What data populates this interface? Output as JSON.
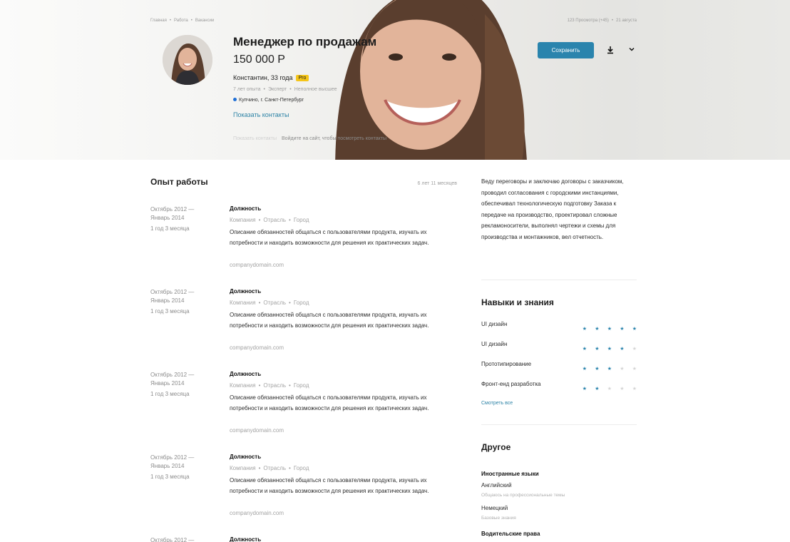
{
  "breadcrumb": [
    "Главная",
    "Работа",
    "Вакансии"
  ],
  "header_meta": {
    "views": "123 Просмотра (+45)",
    "date": "21 августа"
  },
  "profile": {
    "title": "Менеджер по продажам",
    "salary": "150 000 Р",
    "person": "Константин, 33 года",
    "badge": "Pro",
    "experience_meta": [
      "7 лет опыта",
      "Эксперт",
      "Неполное высшее"
    ],
    "location": "Купчино, г. Санкт-Петербург",
    "contacts_link": "Показать контакты",
    "contacts_ghost": "Показать контакты",
    "login_hint": "Войдите на сайт, чтобы посмотреть контакты"
  },
  "actions": {
    "save": "Сохранить",
    "download_icon": "download-icon",
    "more_icon": "chevron-down-icon"
  },
  "experience": {
    "title": "Опыт работы",
    "total": "6 лет 11 месяцев",
    "items": [
      {
        "dates": "Октябрь 2012 — Январь 2014",
        "duration": "1 год 3 месяца",
        "position": "Должность",
        "company": "Компания",
        "industry": "Отрасль",
        "city": "Город",
        "description": "Описание обязанностей общаться с пользователями продукта, изучать их потребности и находить возможности для решения их практических задач.",
        "domain": "companydomain.com"
      },
      {
        "dates": "Октябрь 2012 — Январь 2014",
        "duration": "1 год 3 месяца",
        "position": "Должность",
        "company": "Компания",
        "industry": "Отрасль",
        "city": "Город",
        "description": "Описание обязанностей общаться с пользователями продукта, изучать их потребности и находить возможности для решения их практических задач.",
        "domain": "companydomain.com"
      },
      {
        "dates": "Октябрь 2012 — Январь 2014",
        "duration": "1 год 3 месяца",
        "position": "Должность",
        "company": "Компания",
        "industry": "Отрасль",
        "city": "Город",
        "description": "Описание обязанностей общаться с пользователями продукта, изучать их потребности и находить возможности для решения их практических задач.",
        "domain": "companydomain.com"
      },
      {
        "dates": "Октябрь 2012 — Январь 2014",
        "duration": "1 год 3 месяца",
        "position": "Должность",
        "company": "Компания",
        "industry": "Отрасль",
        "city": "Город",
        "description": "Описание обязанностей общаться с пользователями продукта, изучать их потребности и находить возможности для решения их практических задач.",
        "domain": "companydomain.com"
      },
      {
        "dates": "Октябрь 2012 —",
        "duration": "",
        "position": "Должность",
        "company": "",
        "industry": "",
        "city": "",
        "description": "",
        "domain": ""
      }
    ]
  },
  "about": "Веду переговоры и заключаю договоры с заказчиком, проводил согласования с городскими инстанциями, обеспечивал технологическую подготовку Заказа к передаче на производство, проектировал сложные рекламоносители, выполнял чертежи и схемы для производства и монтажников, вел отчетность.",
  "skills": {
    "title": "Навыки и знания",
    "max_rating": 5,
    "items": [
      {
        "name": "UI дизайн",
        "rating": 5
      },
      {
        "name": "UI дизайн",
        "rating": 4
      },
      {
        "name": "Прототипирование",
        "rating": 3
      },
      {
        "name": "Фронт-енд разработка",
        "rating": 2
      }
    ],
    "see_all": "Смотреть все"
  },
  "other": {
    "title": "Другое",
    "languages_title": "Иностранные языки",
    "languages": [
      {
        "name": "Английский",
        "level": "Общаюсь на профессиональные темы"
      },
      {
        "name": "Немецкий",
        "level": "Базовые знания"
      }
    ],
    "license_title": "Водительские права"
  },
  "colors": {
    "accent": "#2a84ad",
    "badge": "#f5c518",
    "location_dot": "#1f6fd6"
  }
}
